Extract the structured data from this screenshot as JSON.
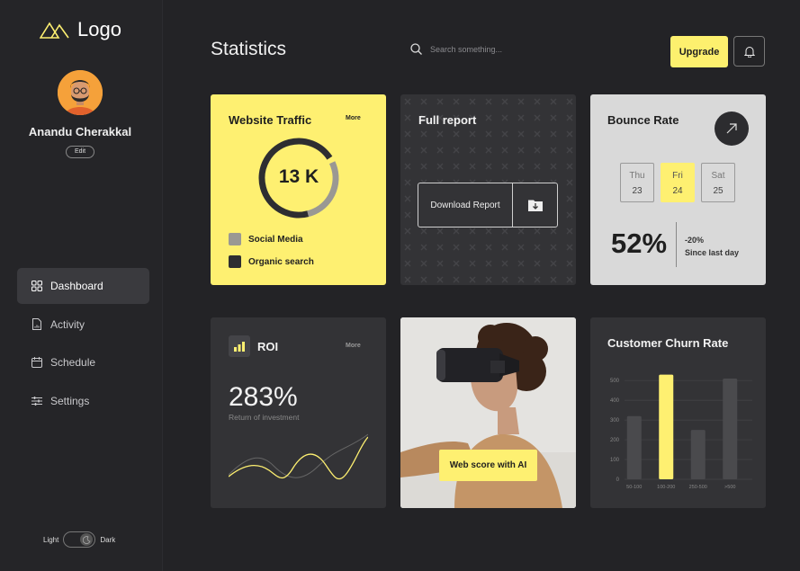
{
  "sidebar": {
    "logo_text": "Logo",
    "user_name": "Anandu Cherakkal",
    "edit_label": "Edit",
    "nav": [
      {
        "label": "Dashboard",
        "icon": "grid-icon",
        "active": true
      },
      {
        "label": "Activity",
        "icon": "document-icon",
        "active": false
      },
      {
        "label": "Schedule",
        "icon": "calendar-icon",
        "active": false
      },
      {
        "label": "Settings",
        "icon": "sliders-icon",
        "active": false
      }
    ],
    "theme": {
      "light_label": "Light",
      "dark_label": "Dark",
      "selected": "Dark"
    }
  },
  "header": {
    "title": "Statistics",
    "search_placeholder": "Search something...",
    "upgrade_label": "Upgrade"
  },
  "traffic": {
    "title": "Website Traffic",
    "more_label": "More",
    "total": "13 K",
    "legend": [
      {
        "label": "Social Media",
        "color": "#9a9893"
      },
      {
        "label": "Organic search",
        "color": "#2e2e31"
      }
    ]
  },
  "report": {
    "title": "Full report",
    "download_label": "Download Report"
  },
  "bounce": {
    "title": "Bounce Rate",
    "days": [
      {
        "name": "Thu",
        "date": "23",
        "selected": false
      },
      {
        "name": "Fri",
        "date": "24",
        "selected": true
      },
      {
        "name": "Sat",
        "date": "25",
        "selected": false
      }
    ],
    "rate": "52%",
    "change": "-20%",
    "change_label": "Since last day"
  },
  "roi": {
    "title": "ROI",
    "more_label": "More",
    "value": "283%",
    "subtitle": "Return of investment"
  },
  "promo": {
    "badge_label": "Web score with AI"
  },
  "churn": {
    "title": "Customer Churn Rate"
  },
  "chart_data": {
    "type": "bar",
    "title": "Customer Churn Rate",
    "categories": [
      "50-100",
      "100-200",
      "250-500",
      ">500"
    ],
    "values": [
      320,
      530,
      250,
      510
    ],
    "highlight_index": 1,
    "yticks": [
      0,
      100,
      200,
      300,
      400,
      500
    ],
    "ylim": [
      0,
      560
    ],
    "grid": true,
    "colors": {
      "bar": "#4a4a4d",
      "highlight": "#fef071"
    }
  },
  "colors": {
    "accent": "#fef071",
    "background": "#232326",
    "card_dark": "#333336",
    "card_light": "#d9d9d9"
  }
}
